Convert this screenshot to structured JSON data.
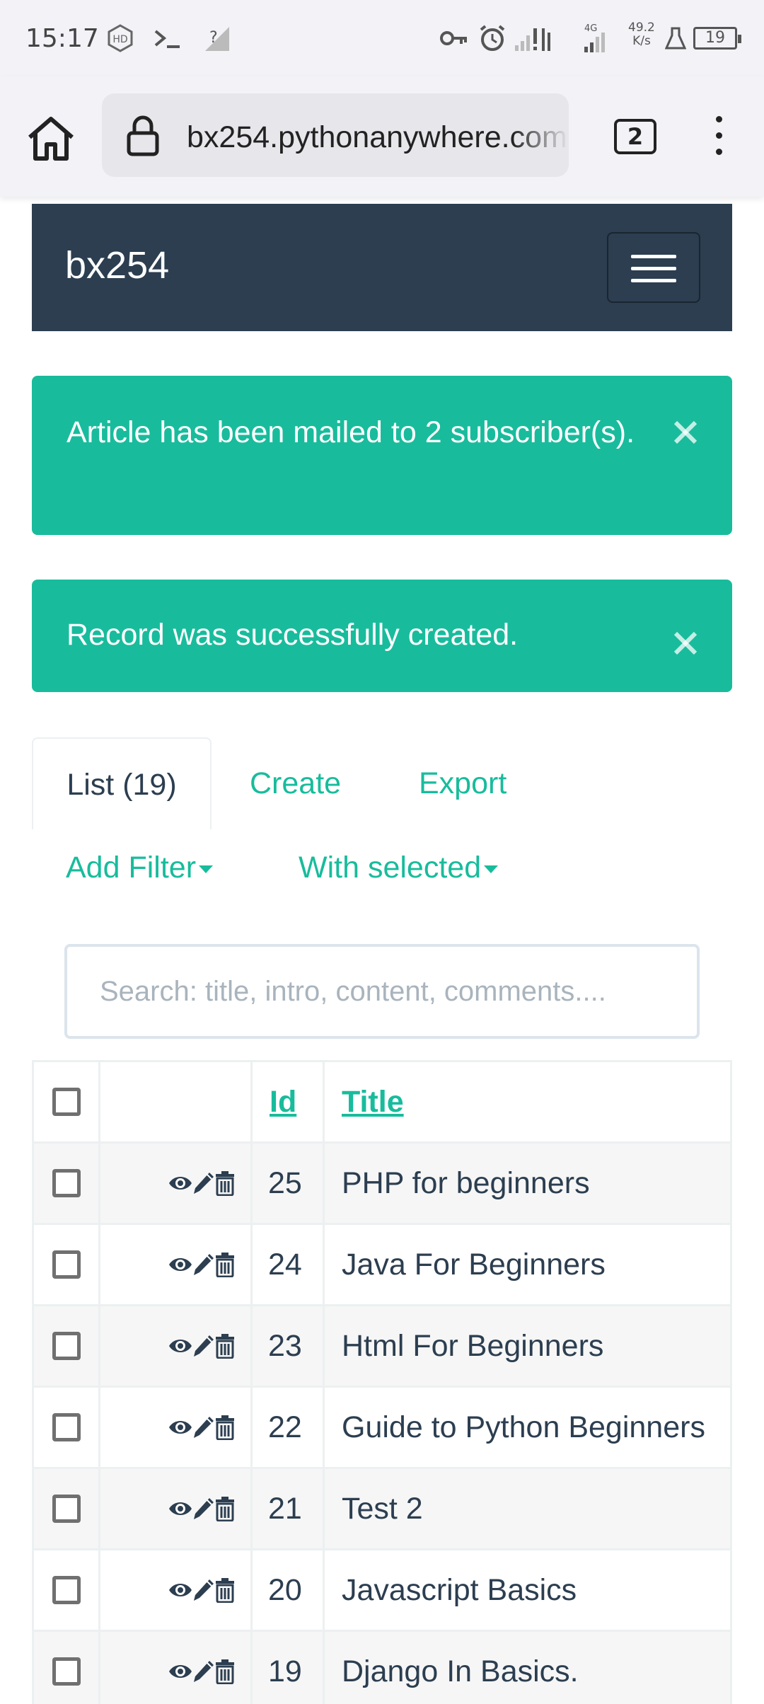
{
  "status_bar": {
    "time": "15:17",
    "network_speed": "49.2",
    "network_unit": "K/s",
    "network_type": "4G",
    "battery": "19"
  },
  "browser": {
    "url": "bx254.pythonanywhere.com",
    "tab_count": "2"
  },
  "navbar": {
    "brand": "bx254"
  },
  "alerts": [
    {
      "message": "Article has been mailed to 2 subscriber(s).",
      "close": "×"
    },
    {
      "message": "Record was successfully created.",
      "close": "×"
    }
  ],
  "tabs": {
    "list": "List (19)",
    "create": "Create",
    "export": "Export"
  },
  "filters": {
    "add_filter": "Add Filter",
    "with_selected": "With selected"
  },
  "search": {
    "placeholder": "Search: title, intro, content, comments...."
  },
  "table": {
    "headers": {
      "id": "Id",
      "title": "Title"
    },
    "rows": [
      {
        "id": "25",
        "title": "PHP for beginners"
      },
      {
        "id": "24",
        "title": "Java For Beginners"
      },
      {
        "id": "23",
        "title": "Html For Beginners"
      },
      {
        "id": "22",
        "title": "Guide to Python Beginners"
      },
      {
        "id": "21",
        "title": "Test 2"
      },
      {
        "id": "20",
        "title": "Javascript Basics"
      },
      {
        "id": "19",
        "title": "Django In Basics."
      }
    ]
  },
  "colors": {
    "accent": "#18bc9c",
    "navbar": "#2c3e50",
    "text": "#2c3e50"
  }
}
